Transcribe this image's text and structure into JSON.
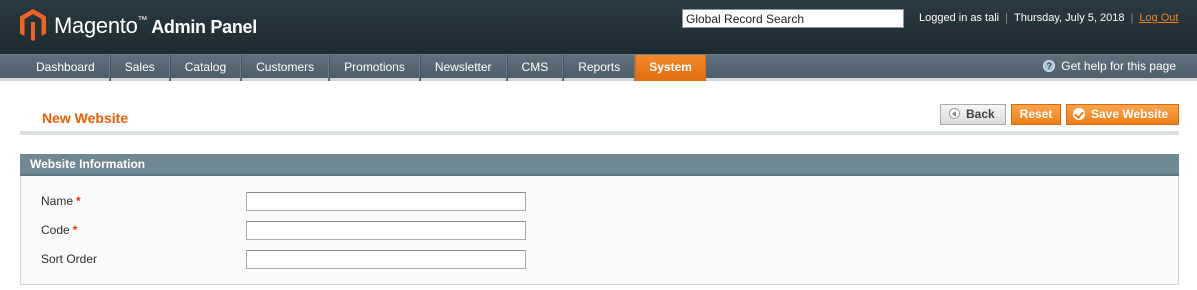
{
  "header": {
    "brand_name": "Magento",
    "brand_tm": "™",
    "brand_sub": "Admin Panel",
    "search_value": "Global Record Search",
    "logged_in": "Logged in as tali",
    "date": "Thursday, July 5, 2018",
    "logout": "Log Out"
  },
  "nav": {
    "items": [
      {
        "label": "Dashboard"
      },
      {
        "label": "Sales"
      },
      {
        "label": "Catalog"
      },
      {
        "label": "Customers"
      },
      {
        "label": "Promotions"
      },
      {
        "label": "Newsletter"
      },
      {
        "label": "CMS"
      },
      {
        "label": "Reports"
      },
      {
        "label": "System"
      }
    ],
    "active": "System",
    "help": "Get help for this page",
    "help_icon": "question-icon"
  },
  "page": {
    "title": "New Website",
    "buttons": {
      "back": "Back",
      "reset": "Reset",
      "save": "Save Website"
    }
  },
  "form": {
    "section_title": "Website Information",
    "fields": [
      {
        "label": "Name",
        "required_mark": "*",
        "value": ""
      },
      {
        "label": "Code",
        "required_mark": "*",
        "value": ""
      },
      {
        "label": "Sort Order",
        "required_mark": "",
        "value": ""
      }
    ]
  },
  "colors": {
    "accent": "#eb5e00",
    "header_bg": "#1d2b32",
    "nav_bg": "#4d5f69",
    "section_bg": "#6f8992",
    "active_tab": "#f58220",
    "required": "#eb340a"
  }
}
